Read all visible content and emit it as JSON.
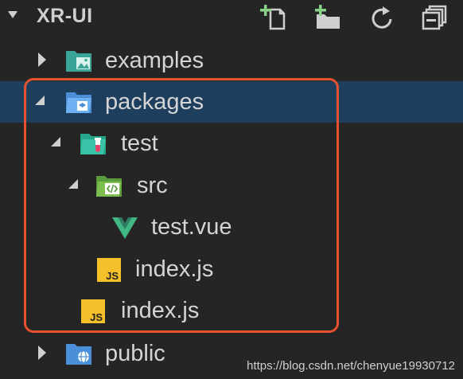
{
  "header": {
    "title": "XR-UI",
    "actions": [
      {
        "name": "new-file",
        "icon": "new-file-icon"
      },
      {
        "name": "new-folder",
        "icon": "new-folder-icon"
      },
      {
        "name": "refresh",
        "icon": "refresh-icon"
      },
      {
        "name": "collapse-all",
        "icon": "collapse-all-icon"
      }
    ]
  },
  "tree": [
    {
      "label": "examples",
      "icon": "folder-images-icon",
      "expanded": false,
      "depth": 0
    },
    {
      "label": "packages",
      "icon": "folder-packages-icon",
      "expanded": true,
      "depth": 0,
      "selected": true
    },
    {
      "label": "test",
      "icon": "folder-test-icon",
      "expanded": true,
      "depth": 1
    },
    {
      "label": "src",
      "icon": "folder-src-icon",
      "expanded": true,
      "depth": 2
    },
    {
      "label": "test.vue",
      "icon": "vue-file-icon",
      "depth": 3
    },
    {
      "label": "index.js",
      "icon": "js-file-icon",
      "depth": 2
    },
    {
      "label": "index.js",
      "icon": "js-file-icon",
      "depth": 1
    },
    {
      "label": "public",
      "icon": "folder-public-icon",
      "expanded": false,
      "depth": 0
    }
  ],
  "watermark": "https://blog.csdn.net/chenyue19930712",
  "colors": {
    "background": "#252526",
    "selected_row": "#1e3e5e",
    "highlight_border": "#e4532e",
    "js_yellow": "#f5c02a",
    "vue_green": "#41b883"
  }
}
